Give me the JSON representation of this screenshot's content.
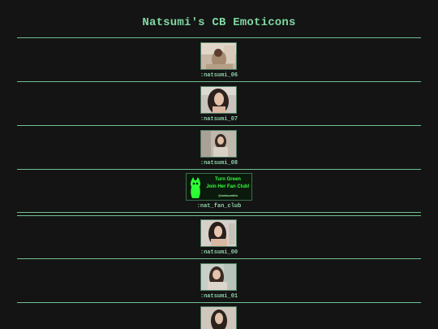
{
  "page": {
    "title": "Natsumi's CB Emoticons"
  },
  "emoticons": [
    {
      "label": ":natsumi_06"
    },
    {
      "label": ":natsumi_07"
    },
    {
      "label": ":natsumi_08"
    },
    {
      "label": ":nat_fan_club",
      "banner": {
        "line1": "Turn Green",
        "line2": "Join Her Fan Club!",
        "line3": "@natsumiito"
      }
    },
    {
      "label": ":natsumi_00"
    },
    {
      "label": ":natsumi_01"
    }
  ],
  "colors": {
    "background": "#141414",
    "accent": "#86d6a3",
    "banner_text": "#34ff3c"
  }
}
